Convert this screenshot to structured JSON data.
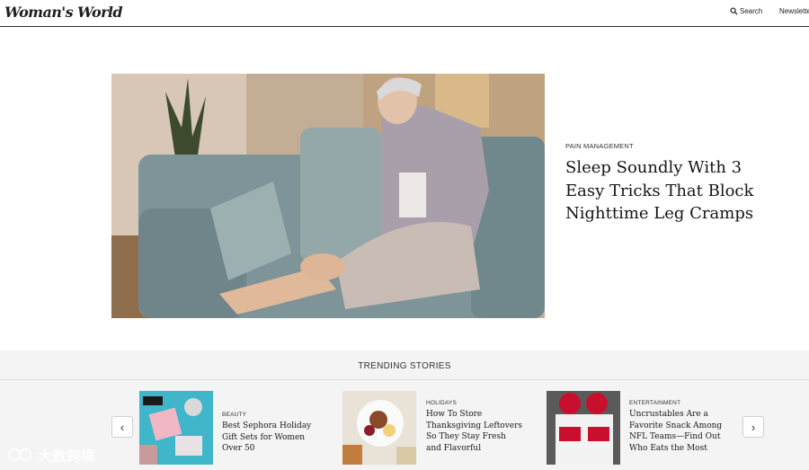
{
  "header": {
    "logo": "Woman's World",
    "search_label": "Search",
    "newsletter_label": "Newsletter"
  },
  "hero": {
    "category": "PAIN MANAGEMENT",
    "title": "Sleep Soundly With 3 Easy Tricks That Block Nighttime Leg Cramps"
  },
  "trending": {
    "title": "TRENDING STORIES",
    "prev_icon": "‹",
    "next_icon": "›",
    "cards": [
      {
        "category": "BEAUTY",
        "title": "Best Sephora Holiday Gift Sets for Women Over 50"
      },
      {
        "category": "HOLIDAYS",
        "title": "How To Store Thanksgiving Leftovers So They Stay Fresh and Flavorful"
      },
      {
        "category": "ENTERTAINMENT",
        "title": "Uncrustables Are a Favorite Snack Among NFL Teams—Find Out Who Eats the Most"
      }
    ]
  },
  "watermark": {
    "text": "大数跨境"
  }
}
